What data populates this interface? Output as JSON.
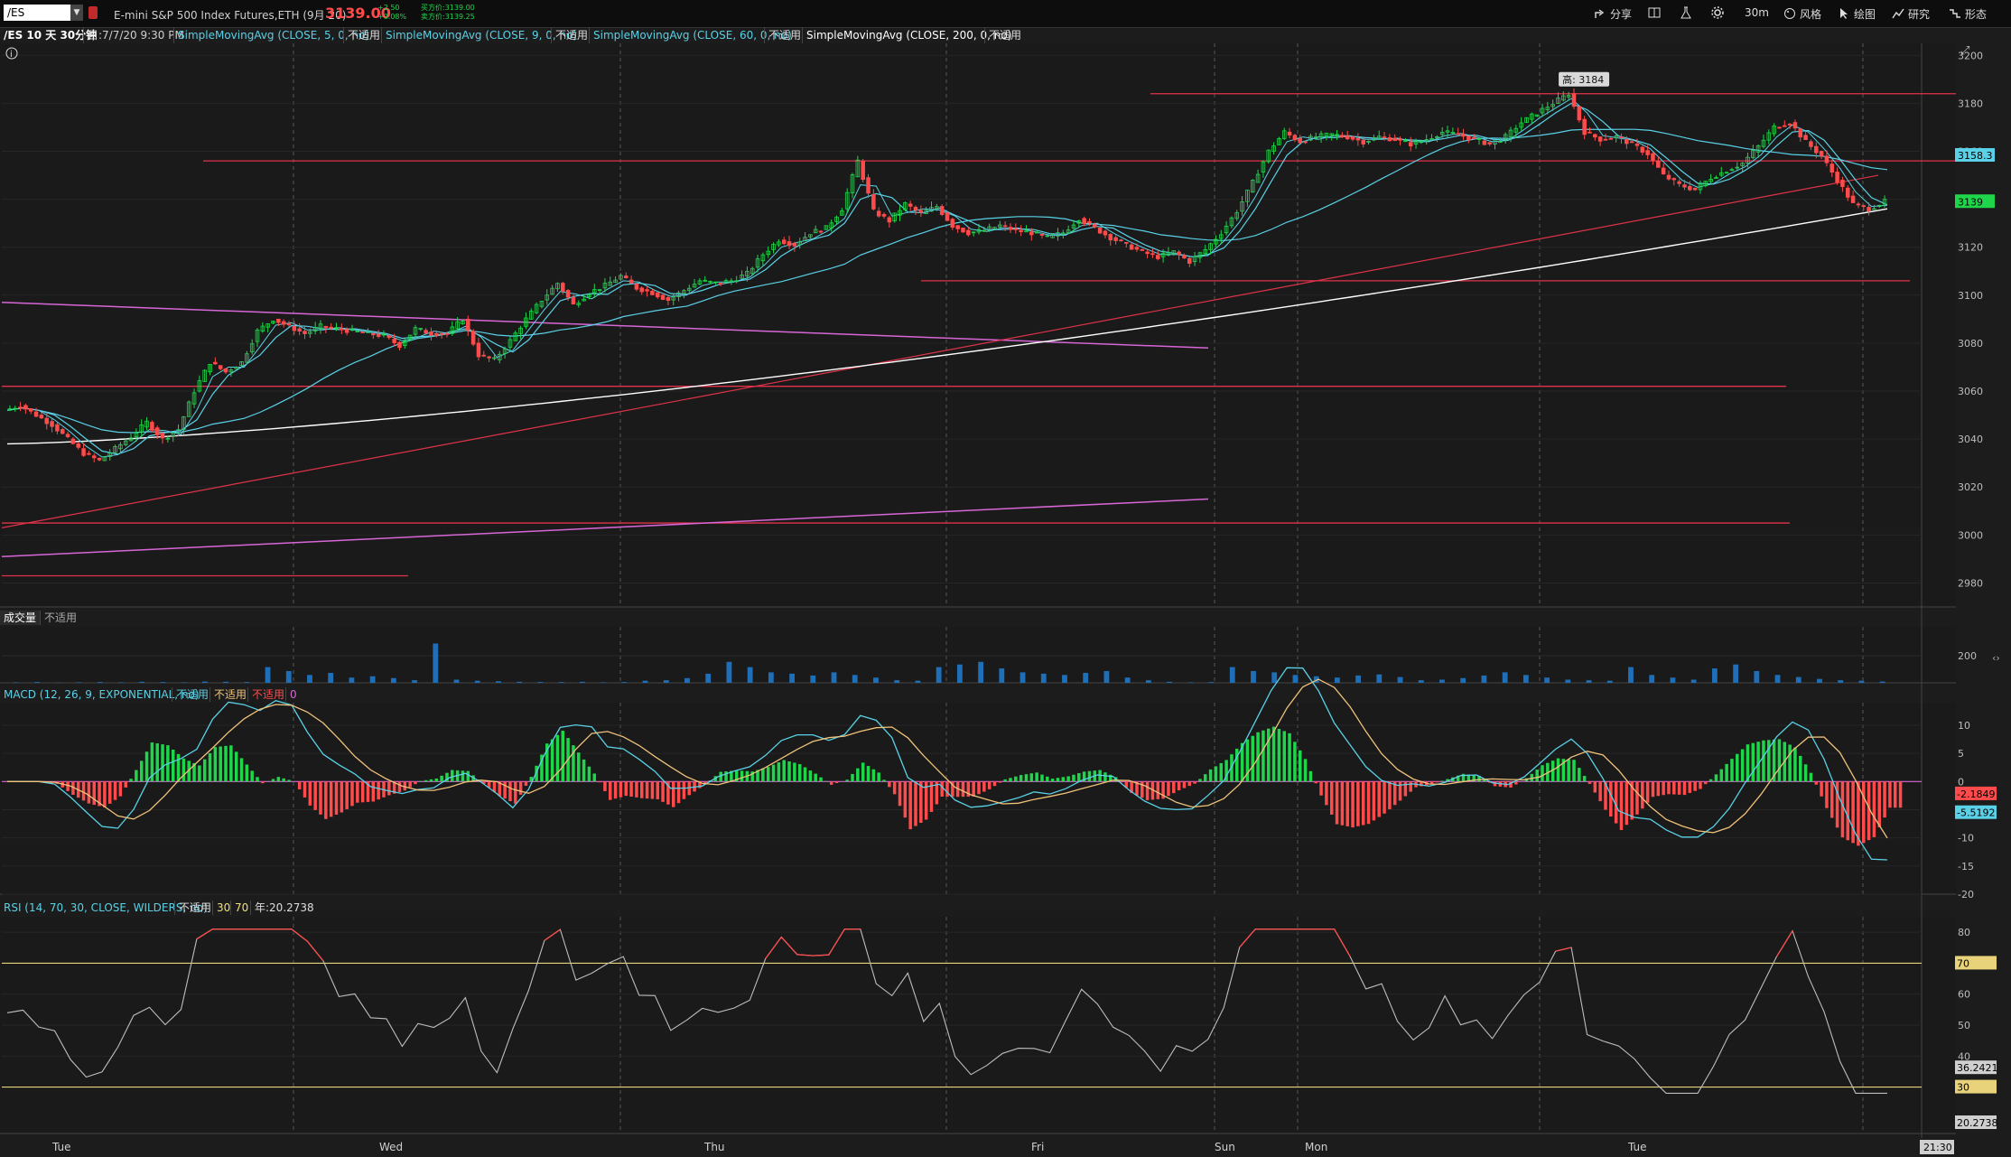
{
  "header": {
    "symbol": "/ES",
    "instrument": "E-mini S&P 500 Index Futures,ETH (9月 20)",
    "last_price": "3139.00",
    "change": "+2.50",
    "change_pct": "+0.08%",
    "bid": "买方价:3139.00",
    "ask": "卖方价:3139.25",
    "tools": [
      "分享",
      "风格",
      "绘图",
      "研究",
      "形态"
    ],
    "timeframe": "30m"
  },
  "infobar": {
    "title": "/ES 10 天 30分钟",
    "date": "日:7/7/20 9:30 PM",
    "studies": [
      {
        "label": "SimpleMovingAvg (CLOSE, 5, 0, no)",
        "color": "#5ad1e6",
        "na": "不适用"
      },
      {
        "label": "SimpleMovingAvg (CLOSE, 9, 0, no)",
        "color": "#5ad1e6",
        "na": "不适用"
      },
      {
        "label": "SimpleMovingAvg (CLOSE, 60, 0, no)",
        "color": "#5ad1e6",
        "na": "不适用"
      },
      {
        "label": "SimpleMovingAvg (CLOSE, 200, 0, no)",
        "color": "#ffffff",
        "na": "不适用"
      }
    ]
  },
  "volume_panel": {
    "label": "成交量",
    "na": "不适用",
    "tick": "200"
  },
  "macd_panel": {
    "label": "MACD (12, 26, 9, EXPONENTIAL, no)",
    "na1": "不适用",
    "na2": "不适用",
    "na3": "不适用",
    "zero": "0",
    "value1": "-2.1849",
    "value2": "-5.5192",
    "ticks": [
      "10",
      "5",
      "0",
      "-5",
      "-10",
      "-15",
      "-20"
    ]
  },
  "rsi_panel": {
    "label": "RSI (14, 70, 30, CLOSE, WILDERS, no)",
    "na": "不适用",
    "ob": "30",
    "os": "70",
    "year": "年:20.2738",
    "value": "36.2421",
    "value_low": "20.2738",
    "ticks": [
      "80",
      "70",
      "60",
      "50",
      "40",
      "30"
    ]
  },
  "x_axis": {
    "labels": [
      "Tue",
      "Wed",
      "Thu",
      "Fri",
      "Sun",
      "Mon",
      "Tue"
    ],
    "time_badge": "21:30"
  },
  "price_badges": {
    "sma": "3158.3",
    "last": "3139",
    "high_label": "高: 3184"
  },
  "colors": {
    "up": "#1fd64b",
    "down": "#ff4b4b",
    "sma_fast": "#5ad1e6",
    "sma_200": "#ffffff",
    "hline": "#e0334a",
    "trend_purple": "#d766d6"
  },
  "chart_data": {
    "type": "line",
    "title": "/ES 10 天 30分钟",
    "x_categories": [
      "Tue",
      "Wed",
      "Thu",
      "Fri",
      "Sun",
      "Mon",
      "Tue"
    ],
    "ylim": [
      2970,
      3205
    ],
    "y_ticks": [
      3200,
      3180,
      3160,
      3140,
      3120,
      3100,
      3080,
      3060,
      3040,
      3020,
      3000,
      2980
    ],
    "horizontal_levels": [
      3184,
      3156,
      3106,
      3062,
      3005,
      2983
    ],
    "price_path": [
      3052,
      3054,
      3050,
      3046,
      3040,
      3034,
      3031,
      3036,
      3041,
      3047,
      3040,
      3044,
      3060,
      3072,
      3068,
      3072,
      3085,
      3090,
      3087,
      3084,
      3087,
      3086,
      3085,
      3084,
      3083,
      3079,
      3086,
      3084,
      3084,
      3090,
      3075,
      3073,
      3081,
      3090,
      3098,
      3105,
      3096,
      3101,
      3104,
      3108,
      3103,
      3101,
      3098,
      3102,
      3106,
      3105,
      3106,
      3109,
      3117,
      3123,
      3121,
      3126,
      3128,
      3136,
      3156,
      3135,
      3131,
      3138,
      3134,
      3137,
      3129,
      3126,
      3127,
      3129,
      3127,
      3126,
      3124,
      3126,
      3132,
      3128,
      3124,
      3121,
      3118,
      3116,
      3118,
      3114,
      3119,
      3126,
      3135,
      3147,
      3160,
      3168,
      3164,
      3166,
      3167,
      3166,
      3164,
      3166,
      3165,
      3163,
      3165,
      3168,
      3167,
      3165,
      3163,
      3166,
      3172,
      3176,
      3180,
      3184,
      3168,
      3165,
      3166,
      3163,
      3159,
      3150,
      3146,
      3144,
      3149,
      3152,
      3155,
      3162,
      3170,
      3172,
      3164,
      3158,
      3148,
      3138,
      3136,
      3139
    ],
    "volume_values": [
      2,
      3,
      1,
      2,
      3,
      2,
      4,
      3,
      2,
      5,
      4,
      3,
      60,
      45,
      30,
      38,
      20,
      25,
      18,
      10,
      150,
      12,
      8,
      6,
      4,
      3,
      3,
      4,
      2,
      3,
      8,
      10,
      18,
      35,
      80,
      60,
      40,
      35,
      28,
      40,
      30,
      20,
      10,
      8,
      60,
      70,
      80,
      55,
      40,
      35,
      30,
      38,
      45,
      20,
      10,
      4,
      2,
      3,
      60,
      45,
      40,
      30,
      25,
      20,
      28,
      32,
      22,
      10,
      12,
      18,
      28,
      40,
      30,
      20,
      12,
      10,
      8,
      60,
      30,
      20,
      12,
      55,
      70,
      45,
      30,
      22,
      15,
      10,
      8,
      5
    ],
    "macd": {
      "value": -2.1849,
      "signal": -5.5192
    },
    "rsi": {
      "value": 36.2421,
      "overbought": 70,
      "oversold": 30
    }
  }
}
